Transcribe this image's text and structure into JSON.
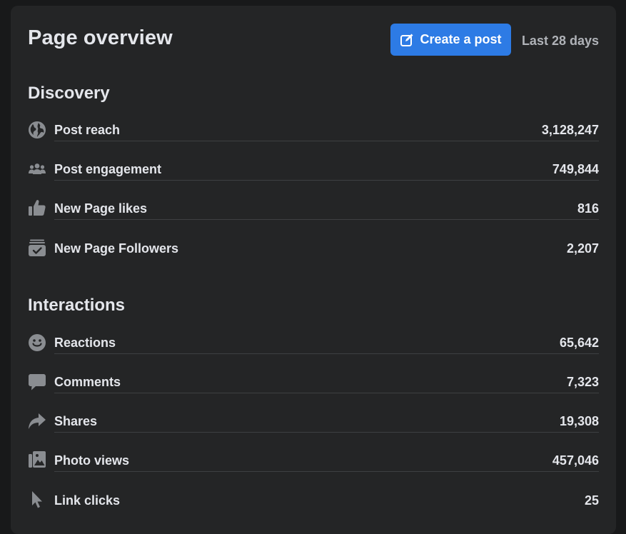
{
  "header": {
    "title": "Page overview",
    "create_post_label": "Create a post",
    "date_range": "Last 28 days"
  },
  "discovery": {
    "title": "Discovery",
    "items": [
      {
        "label": "Post reach",
        "value": "3,128,247",
        "icon": "globe-icon"
      },
      {
        "label": "Post engagement",
        "value": "749,844",
        "icon": "people-icon"
      },
      {
        "label": "New Page likes",
        "value": "816",
        "icon": "thumbs-up-icon"
      },
      {
        "label": "New Page Followers",
        "value": "2,207",
        "icon": "follow-check-icon"
      }
    ]
  },
  "interactions": {
    "title": "Interactions",
    "items": [
      {
        "label": "Reactions",
        "value": "65,642",
        "icon": "smiley-icon"
      },
      {
        "label": "Comments",
        "value": "7,323",
        "icon": "comment-bubble-icon"
      },
      {
        "label": "Shares",
        "value": "19,308",
        "icon": "share-arrow-icon"
      },
      {
        "label": "Photo views",
        "value": "457,046",
        "icon": "photos-icon"
      },
      {
        "label": "Link clicks",
        "value": "25",
        "icon": "cursor-icon"
      }
    ]
  },
  "colors": {
    "background": "#18191a",
    "card": "#242526",
    "accent": "#2d7be5",
    "text_primary": "#e4e6eb",
    "text_secondary": "#b0b3b8",
    "icon": "#8a8d91",
    "divider": "#3e4042"
  }
}
